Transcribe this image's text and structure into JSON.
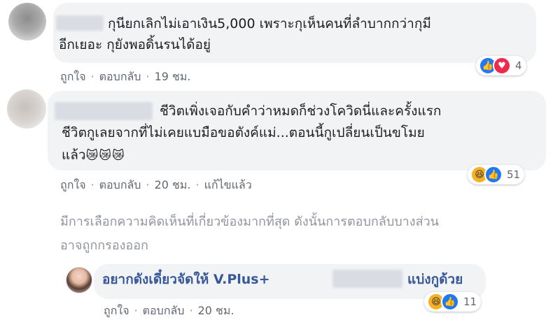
{
  "comments": [
    {
      "text_line1": "กุนียกเลิกไม่เอาเงิน5,000 เพราะกุเห็นคนที่ลำบากกว่ากุมี",
      "text_line2": "อีกเยอะ กุยังพอดิ้นรนได้อยู่",
      "like_label": "ถูกใจ",
      "reply_label": "ตอบกลับ",
      "time": "19 ชม.",
      "reaction_count": "4",
      "reactions": [
        "like-icon",
        "love-icon"
      ]
    },
    {
      "text_line1": "ชีวิตเพิ่งเจอกับคำว่าหมดก็ช่วงโควิดนี่และครั้งแรก",
      "text_line2": "ชีวิตกูเลยจากที่ไม่เคยแบมือขอตังค์แม่...ตอนนี้กูเปลี่ยนเป็นขโมย",
      "text_line3": "แล้ว",
      "text_emoji": "😿😿😿",
      "like_label": "ถูกใจ",
      "reply_label": "ตอบกลับ",
      "time": "20 ชม.",
      "edited_label": "แก้ไขแล้ว",
      "reaction_count": "51",
      "reactions": [
        "haha-icon",
        "like-icon"
      ]
    }
  ],
  "notice": {
    "line1": "มีการเลือกความคิดเห็นที่เกี่ยวข้องมากที่สุด ดังนั้นการตอบกลับบางส่วน",
    "line2": "อาจถูกกรองออก"
  },
  "reply": {
    "text_head": "อยากดังเดี๋ยวจัดให้ V.Plus+",
    "text_tail": "แบ่งกูด้วย",
    "like_label": "ถูกใจ",
    "reply_label": "ตอบกลับ",
    "time": "20 ชม.",
    "reaction_count": "11",
    "reactions": [
      "haha-icon",
      "like-icon"
    ]
  },
  "colors": {
    "bubble": "#f2f3f5",
    "link": "#385898",
    "meta": "#606770",
    "like": "#2078f4",
    "love": "#f0284a",
    "haha": "#f7b125"
  }
}
